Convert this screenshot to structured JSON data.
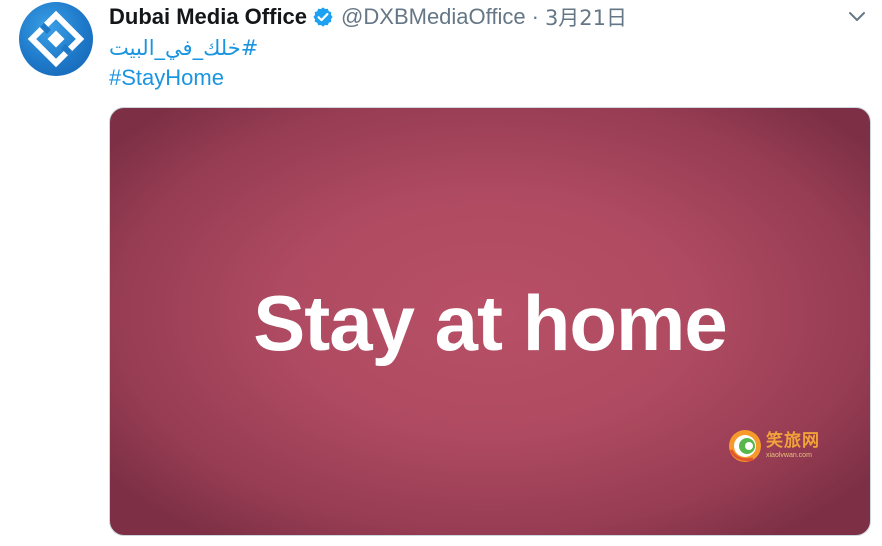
{
  "tweet": {
    "author": {
      "name": "Dubai Media Office",
      "handle": "@DXBMediaOffice",
      "verified": true
    },
    "separator": "·",
    "date": "3月21日",
    "hashtags": [
      "#خلك_في_البيت",
      "#StayHome"
    ],
    "media": {
      "title": "Stay at home",
      "watermark_name": "笑旅网",
      "watermark_url": "xiaolvwan.com"
    }
  },
  "colors": {
    "accent": "#1b95e0",
    "verified": "#1da1f2",
    "muted": "#657786",
    "media_bg": "#b05066"
  },
  "icons": {
    "avatar": "dubai-media-office-logo",
    "verified": "verified-badge-icon",
    "menu": "chevron-down-icon"
  }
}
